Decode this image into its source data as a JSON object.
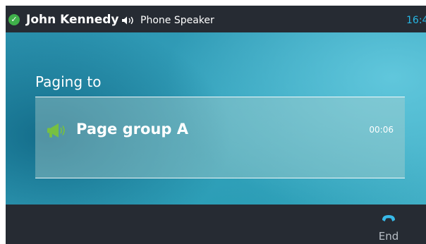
{
  "status_bar": {
    "status_icon": "registered-check-icon",
    "contact_name": "John Kennedy",
    "audio_icon": "speaker-icon",
    "audio_mode": "Phone Speaker",
    "clock": "16:4"
  },
  "paging": {
    "title": "Paging to",
    "icon": "megaphone-icon",
    "group_name": "Page group A",
    "duration": "00:06"
  },
  "softkeys": {
    "end": {
      "icon": "hang-up-handset-icon",
      "label": "End"
    }
  },
  "colors": {
    "bar_background": "#262b33",
    "accent_green": "#77c041",
    "status_green": "#3fb04a",
    "clock_blue": "#27b7e5",
    "end_icon_blue": "#38b9e8"
  }
}
